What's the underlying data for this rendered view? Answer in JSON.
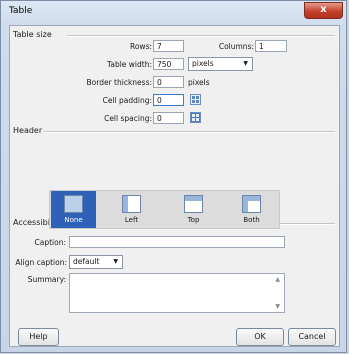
{
  "window": {
    "title": "Table",
    "close_glyph": "x"
  },
  "table_size": {
    "section_label": "Table size",
    "rows_label": "Rows:",
    "rows_value": "7",
    "columns_label": "Columns:",
    "columns_value": "1",
    "width_label": "Table width:",
    "width_value": "750",
    "width_unit": "pixels",
    "border_label": "Border thickness:",
    "border_value": "0",
    "border_unit": "pixels",
    "padding_label": "Cell padding:",
    "padding_value": "0",
    "spacing_label": "Cell spacing:",
    "spacing_value": "0"
  },
  "header": {
    "section_label": "Header",
    "options": [
      "None",
      "Left",
      "Top",
      "Both"
    ],
    "selected": "None"
  },
  "accessibility": {
    "section_label": "Accessibility",
    "caption_label": "Caption:",
    "caption_value": "",
    "align_label": "Align caption:",
    "align_value": "default",
    "summary_label": "Summary:",
    "summary_value": ""
  },
  "buttons": {
    "help": "Help",
    "ok": "OK",
    "cancel": "Cancel"
  },
  "icons": {
    "padding_icon": "cell-padding-icon",
    "spacing_icon": "cell-spacing-icon"
  }
}
